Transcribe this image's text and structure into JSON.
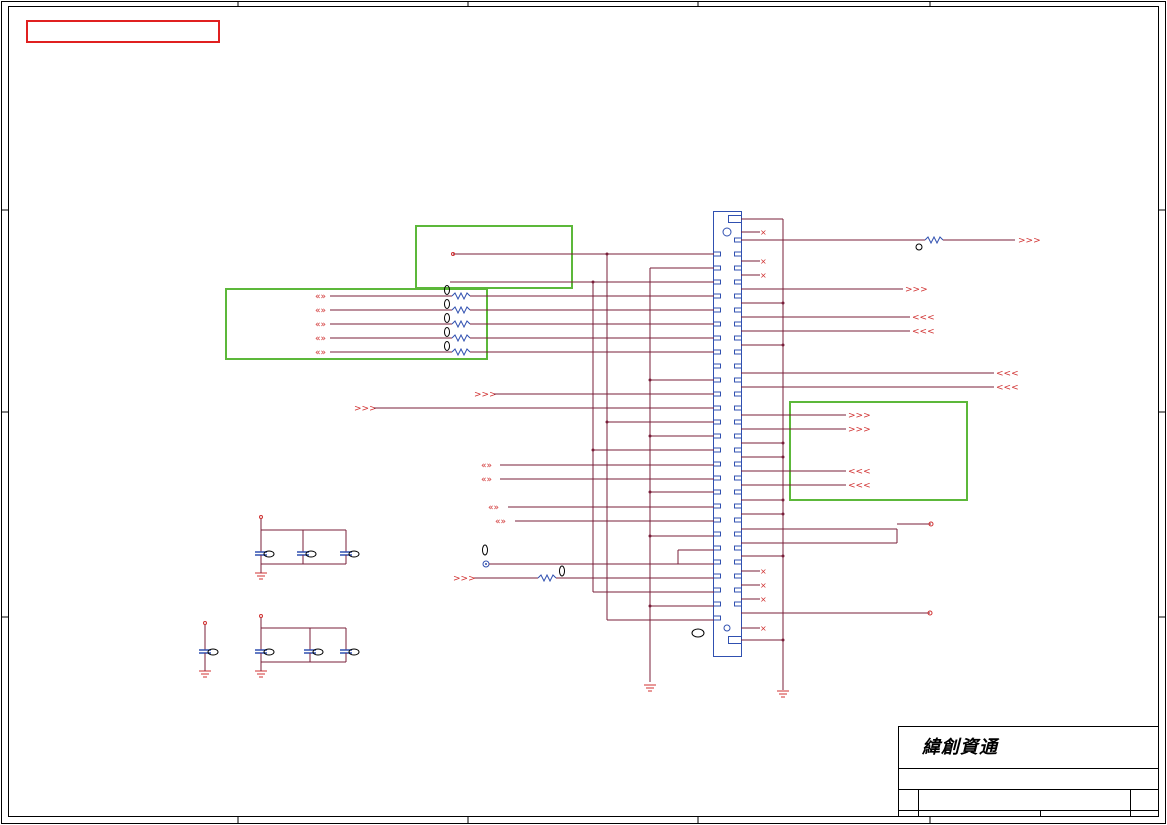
{
  "title_block": {
    "company_name": "緯創資通"
  },
  "colors": {
    "frame": "#7a1f3a",
    "wire": "#7a1f3a",
    "pin": "#d03030",
    "connector": "#3050b0",
    "highlight_red": "#e02020",
    "highlight_green": "#5cb83a",
    "resistor": "#3050b0"
  },
  "icons": {
    "ground": "ground-icon",
    "capacitor": "capacitor-icon",
    "resistor": "resistor-icon",
    "off_page_connector": "off-page-connector-icon",
    "no_connect": "no-connect-icon"
  }
}
